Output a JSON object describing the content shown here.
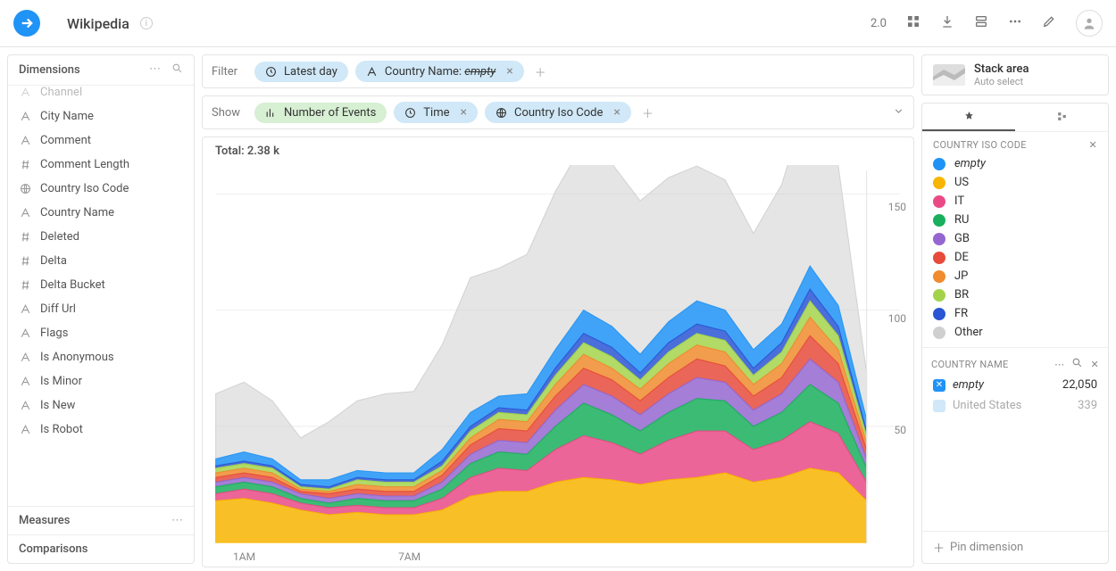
{
  "header": {
    "title": "Wikipedia",
    "version": "2.0"
  },
  "sidebar": {
    "title": "Dimensions",
    "items": [
      {
        "icon": "text",
        "label": "Channel"
      },
      {
        "icon": "text",
        "label": "City Name"
      },
      {
        "icon": "text",
        "label": "Comment"
      },
      {
        "icon": "hash",
        "label": "Comment Length"
      },
      {
        "icon": "globe",
        "label": "Country Iso Code"
      },
      {
        "icon": "text",
        "label": "Country Name"
      },
      {
        "icon": "hash",
        "label": "Deleted"
      },
      {
        "icon": "hash",
        "label": "Delta"
      },
      {
        "icon": "hash",
        "label": "Delta Bucket"
      },
      {
        "icon": "text",
        "label": "Diff Url"
      },
      {
        "icon": "text",
        "label": "Flags"
      },
      {
        "icon": "text",
        "label": "Is Anonymous"
      },
      {
        "icon": "text",
        "label": "Is Minor"
      },
      {
        "icon": "text",
        "label": "Is New"
      },
      {
        "icon": "text",
        "label": "Is Robot"
      }
    ],
    "measures_label": "Measures",
    "comparisons_label": "Comparisons"
  },
  "filter": {
    "label": "Filter",
    "pills": [
      {
        "icon": "clock",
        "text": "Latest day"
      },
      {
        "icon": "text",
        "prefix": "Country Name: ",
        "value": "empty",
        "strike": true,
        "closable": true
      }
    ]
  },
  "show": {
    "label": "Show",
    "pills": [
      {
        "icon": "bar",
        "text": "Number of Events",
        "color": "green"
      },
      {
        "icon": "clock",
        "text": "Time",
        "color": "blue",
        "closable": true
      },
      {
        "icon": "globe",
        "text": "Country Iso Code",
        "color": "blue",
        "closable": true
      }
    ]
  },
  "chart": {
    "total_label": "Total: ",
    "total_value": "2.38 k",
    "xticks": [
      "1AM",
      "7AM"
    ],
    "yticks": [
      "50",
      "100",
      "150"
    ]
  },
  "vis": {
    "name": "Stack area",
    "sub": "Auto select"
  },
  "legend": {
    "head": "COUNTRY ISO CODE",
    "items": [
      {
        "color": "#2093f6",
        "label": "empty",
        "italic": true
      },
      {
        "color": "#f7b500",
        "label": "US"
      },
      {
        "color": "#e94a86",
        "label": "IT"
      },
      {
        "color": "#1aaf5d",
        "label": "RU"
      },
      {
        "color": "#9467d0",
        "label": "GB"
      },
      {
        "color": "#e64b3c",
        "label": "DE"
      },
      {
        "color": "#f08b2e",
        "label": "JP"
      },
      {
        "color": "#a3d34b",
        "label": "BR"
      },
      {
        "color": "#2a55d4",
        "label": "FR"
      },
      {
        "color": "#cfcfcf",
        "label": "Other"
      }
    ]
  },
  "country_panel": {
    "head": "COUNTRY NAME",
    "rows": [
      {
        "checked": true,
        "label": "empty",
        "italic": true,
        "value": "22,050"
      },
      {
        "checked": false,
        "label": "United States",
        "value": "339",
        "muted": true
      }
    ],
    "pin_label": "Pin dimension"
  },
  "chart_data": {
    "type": "area",
    "title": "",
    "xlabel": "Time",
    "ylabel": "Number of Events",
    "ylim": [
      0,
      160
    ],
    "total": 2380,
    "x_hours": [
      0,
      1,
      2,
      3,
      4,
      5,
      6,
      7,
      8,
      9,
      10,
      11,
      12,
      13,
      14,
      15,
      16,
      17,
      18,
      19,
      20,
      21,
      22,
      23
    ],
    "series": [
      {
        "name": "empty",
        "color": "#2093f6",
        "values": [
          3,
          4,
          3,
          2,
          3,
          3,
          3,
          3,
          5,
          6,
          5,
          7,
          8,
          10,
          9,
          8,
          9,
          10,
          9,
          8,
          8,
          10,
          9,
          5
        ]
      },
      {
        "name": "US",
        "color": "#f7b500",
        "values": [
          18,
          19,
          17,
          14,
          12,
          13,
          12,
          12,
          14,
          20,
          22,
          22,
          26,
          28,
          27,
          25,
          27,
          28,
          30,
          26,
          28,
          32,
          30,
          18
        ]
      },
      {
        "name": "IT",
        "color": "#e94a86",
        "values": [
          3,
          4,
          4,
          3,
          3,
          3,
          3,
          3,
          5,
          8,
          10,
          9,
          14,
          18,
          16,
          13,
          17,
          20,
          18,
          14,
          16,
          20,
          17,
          8
        ]
      },
      {
        "name": "RU",
        "color": "#1aaf5d",
        "values": [
          3,
          3,
          3,
          2,
          2,
          3,
          3,
          3,
          4,
          6,
          7,
          7,
          10,
          14,
          12,
          10,
          12,
          14,
          13,
          10,
          12,
          16,
          13,
          6
        ]
      },
      {
        "name": "GB",
        "color": "#9467d0",
        "values": [
          2,
          2,
          2,
          2,
          2,
          2,
          2,
          2,
          3,
          4,
          5,
          5,
          7,
          8,
          8,
          7,
          8,
          9,
          8,
          7,
          8,
          11,
          9,
          4
        ]
      },
      {
        "name": "DE",
        "color": "#e64b3c",
        "values": [
          2,
          2,
          2,
          1,
          2,
          2,
          2,
          2,
          3,
          4,
          5,
          5,
          6,
          7,
          7,
          6,
          7,
          8,
          7,
          6,
          7,
          10,
          8,
          4
        ]
      },
      {
        "name": "JP",
        "color": "#f08b2e",
        "values": [
          2,
          2,
          2,
          1,
          1,
          2,
          2,
          2,
          2,
          3,
          4,
          4,
          5,
          6,
          5,
          5,
          6,
          6,
          6,
          5,
          6,
          8,
          6,
          3
        ]
      },
      {
        "name": "BR",
        "color": "#a3d34b",
        "values": [
          2,
          2,
          2,
          1,
          1,
          2,
          2,
          2,
          2,
          3,
          3,
          3,
          4,
          5,
          5,
          4,
          5,
          5,
          5,
          4,
          5,
          7,
          6,
          3
        ]
      },
      {
        "name": "FR",
        "color": "#2a55d4",
        "values": [
          1,
          1,
          1,
          1,
          1,
          1,
          1,
          1,
          2,
          2,
          2,
          2,
          3,
          4,
          4,
          3,
          4,
          4,
          4,
          3,
          4,
          5,
          4,
          2
        ]
      },
      {
        "name": "Other",
        "color": "#cfcfcf",
        "values": [
          28,
          30,
          25,
          18,
          25,
          30,
          34,
          35,
          45,
          58,
          55,
          60,
          68,
          72,
          70,
          66,
          62,
          58,
          56,
          50,
          60,
          75,
          60,
          20
        ]
      }
    ]
  }
}
